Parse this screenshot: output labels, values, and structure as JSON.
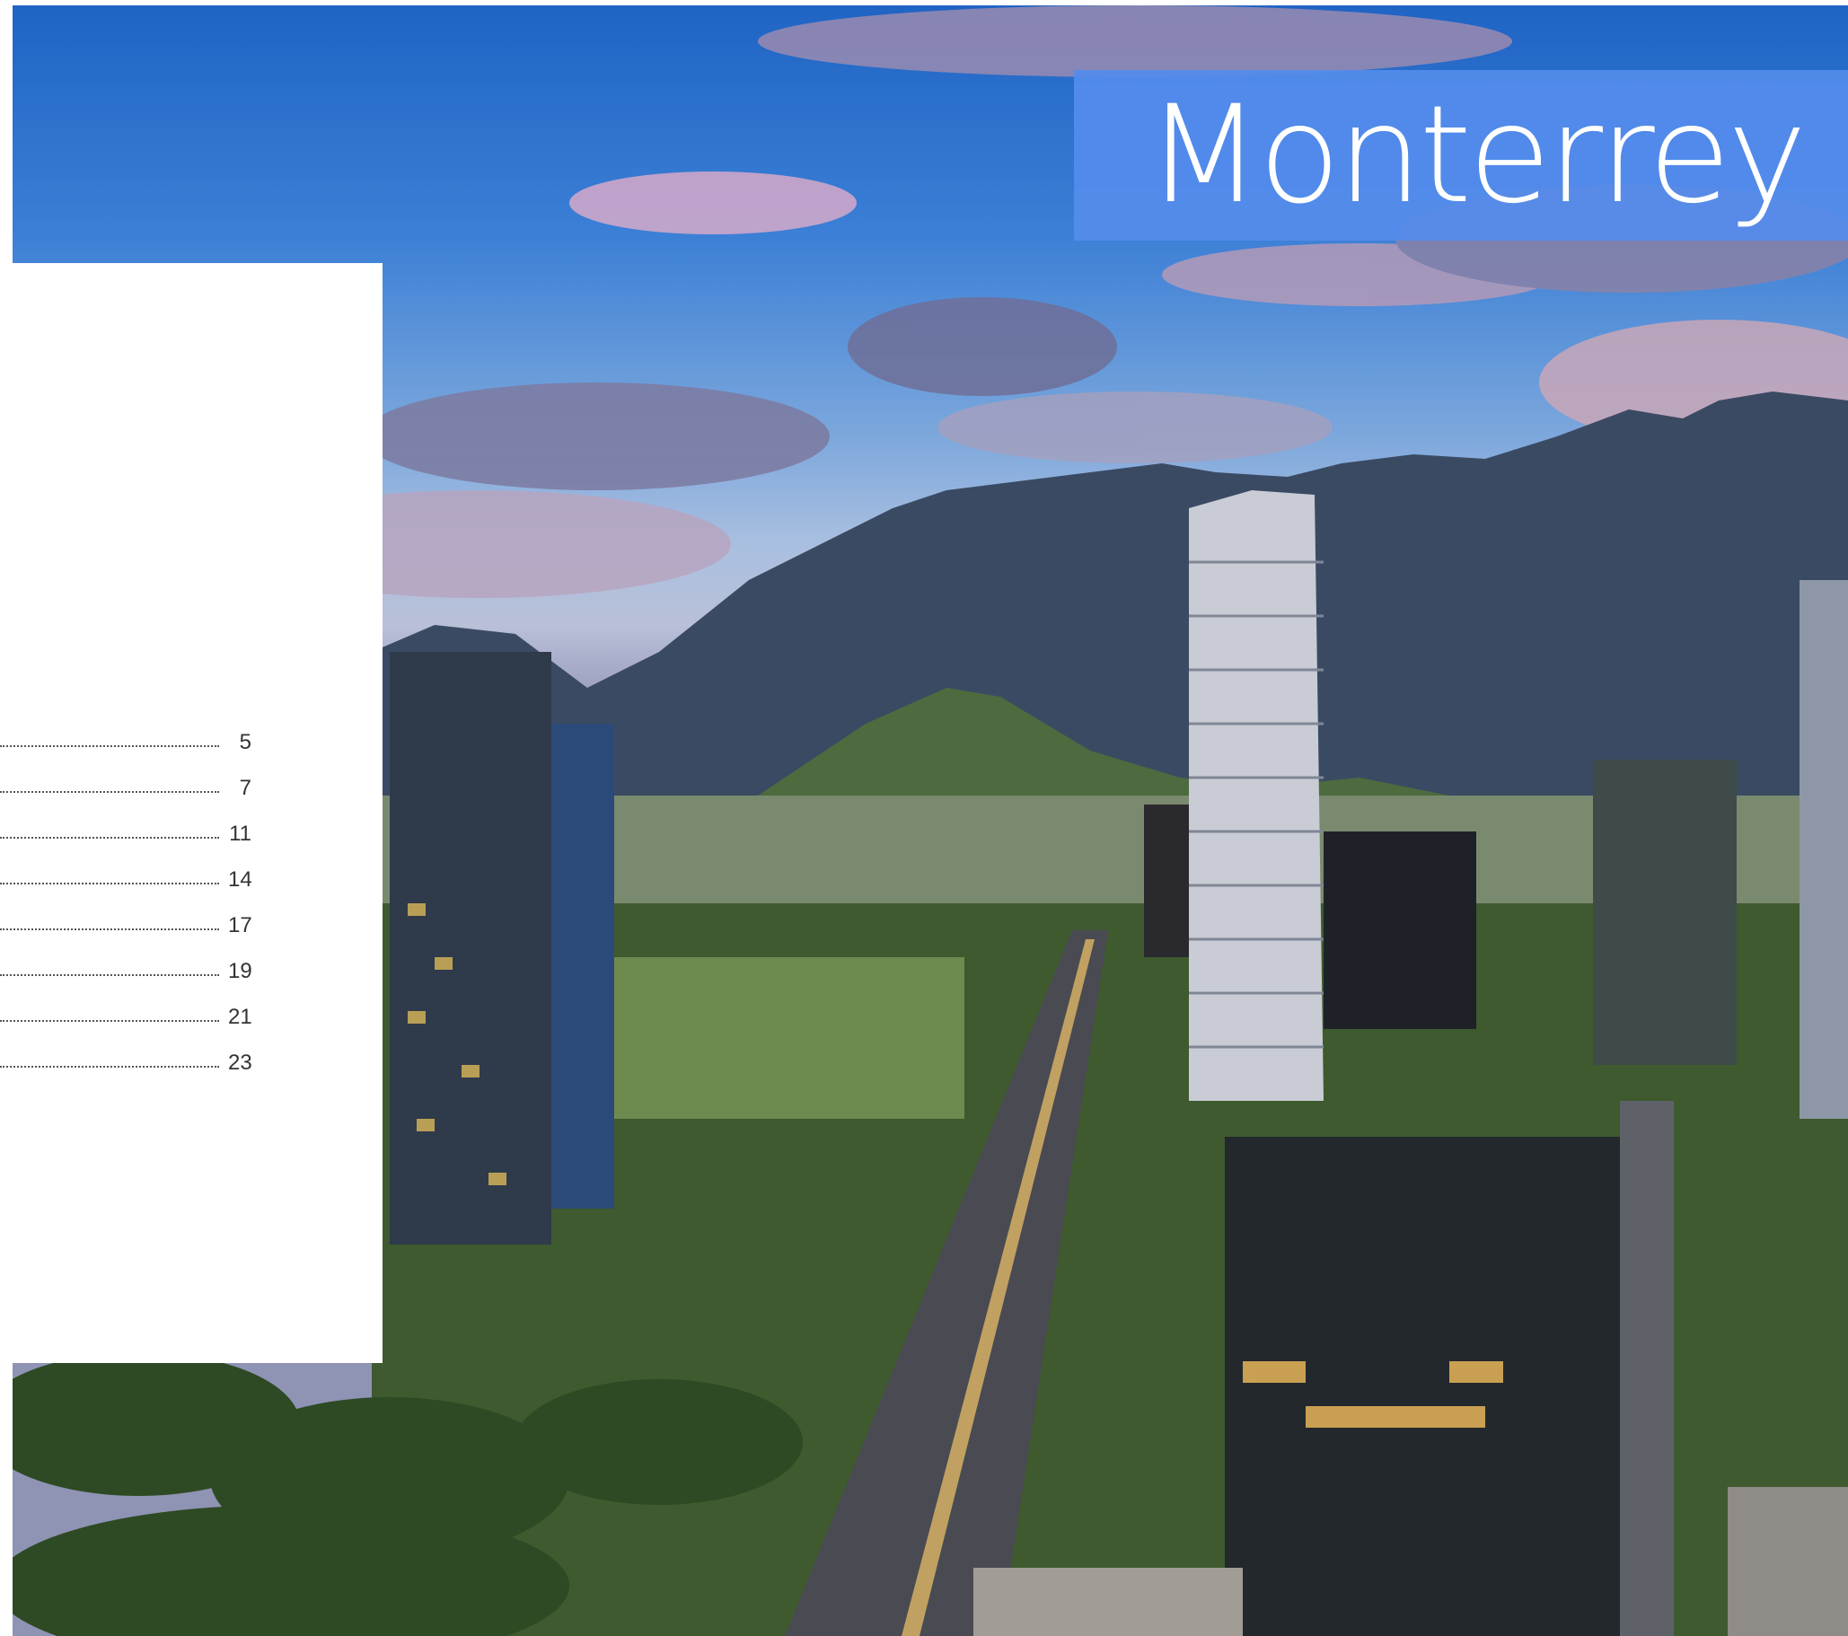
{
  "header": {
    "title": "Monterrey"
  },
  "toc": {
    "entries": [
      {
        "page": "5"
      },
      {
        "page": "7"
      },
      {
        "page": "11"
      },
      {
        "page": "14"
      },
      {
        "page": "17"
      },
      {
        "page": "19"
      },
      {
        "page": "21"
      },
      {
        "page": "23"
      }
    ]
  },
  "colors": {
    "banner": "#548cec",
    "panel": "#ffffff",
    "sky": "#2b6fcf"
  }
}
